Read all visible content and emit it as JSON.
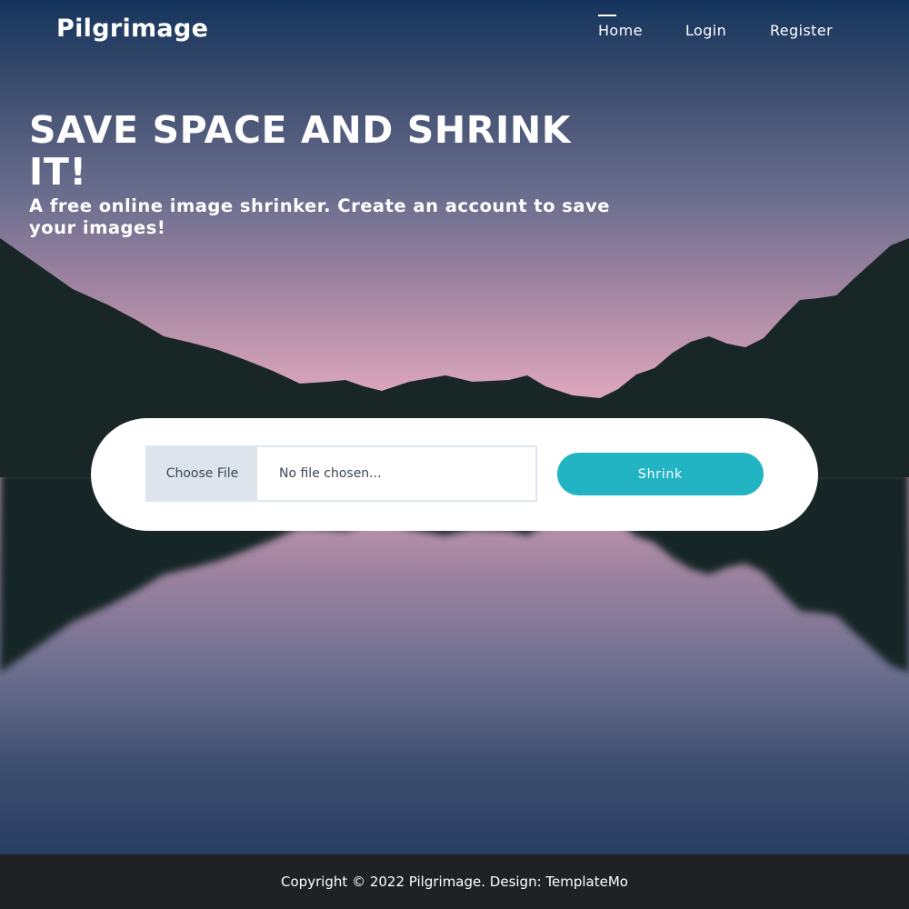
{
  "header": {
    "brand": "Pilgrimage",
    "nav": [
      {
        "label": "Home",
        "active": true
      },
      {
        "label": "Login",
        "active": false
      },
      {
        "label": "Register",
        "active": false
      }
    ]
  },
  "hero": {
    "title": "SAVE SPACE AND SHRINK IT!",
    "subtitle": "A free online image shrinker. Create an account to save your images!"
  },
  "upload_form": {
    "choose_file_label": "Choose File",
    "file_status": "No file chosen...",
    "submit_label": "Shrink"
  },
  "footer": {
    "copyright": "Copyright © 2022 Pilgrimage. Design: TemplateMo"
  },
  "colors": {
    "accent": "#23b4c4",
    "footer_bg": "#202124",
    "mountain": "#182626"
  }
}
